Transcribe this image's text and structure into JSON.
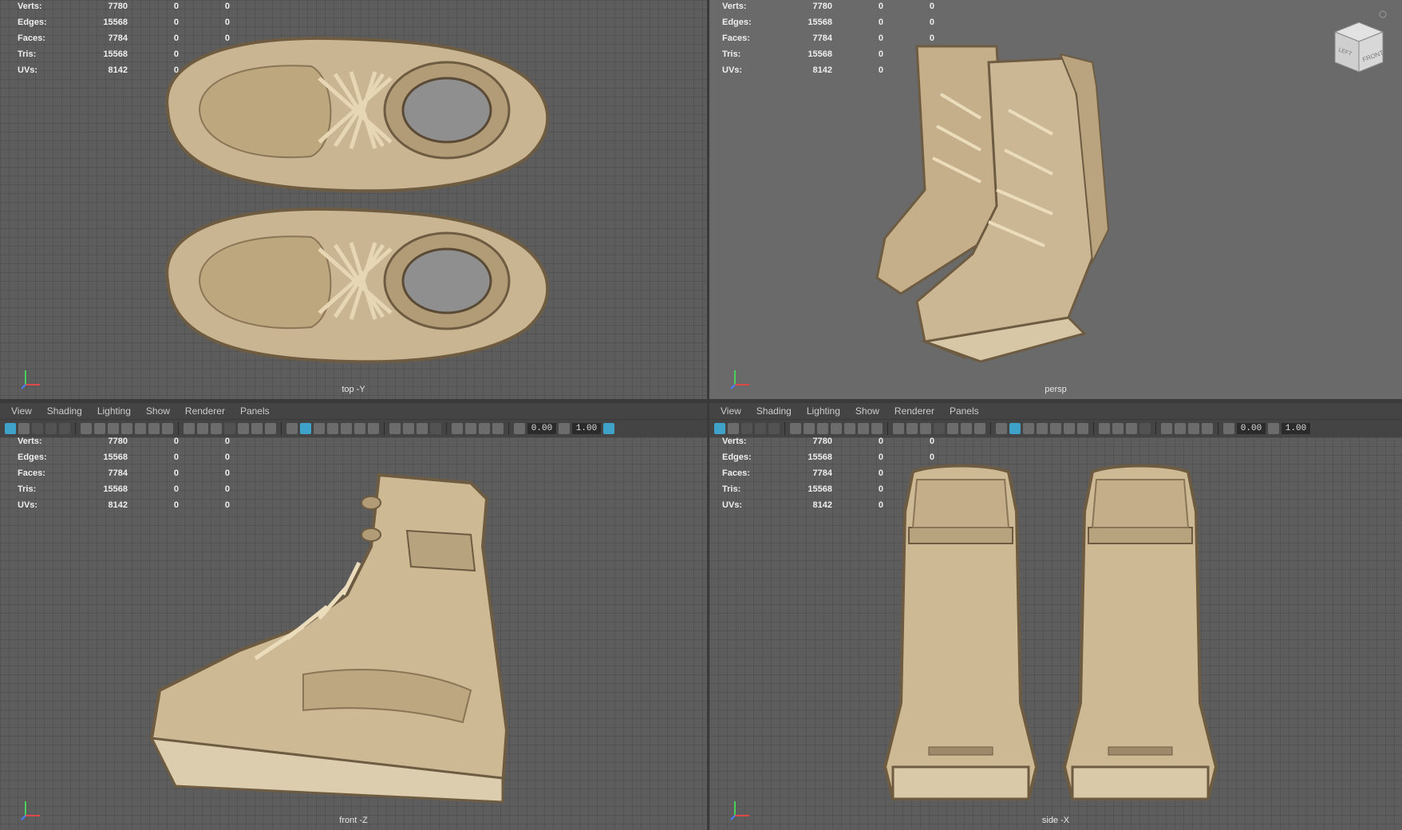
{
  "menu": [
    "View",
    "Shading",
    "Lighting",
    "Show",
    "Renderer",
    "Panels"
  ],
  "stats": [
    {
      "label": "Verts:",
      "value": "7780",
      "z1": "0",
      "z2": "0"
    },
    {
      "label": "Edges:",
      "value": "15568",
      "z1": "0",
      "z2": "0"
    },
    {
      "label": "Faces:",
      "value": "7784",
      "z1": "0",
      "z2": "0"
    },
    {
      "label": "Tris:",
      "value": "15568",
      "z1": "0",
      "z2": "0"
    },
    {
      "label": "UVs:",
      "value": "8142",
      "z1": "0",
      "z2": "0"
    }
  ],
  "toolbar": {
    "value_a": "0.00",
    "value_b": "1.00"
  },
  "viewports": {
    "top": {
      "camera": "top -Y"
    },
    "persp": {
      "camera": "persp"
    },
    "front": {
      "camera": "front -Z"
    },
    "side": {
      "camera": "side -X"
    }
  },
  "viewcube": {
    "face_front": "FRONT",
    "face_left": "LEFT"
  },
  "colors": {
    "accent": "#3fa3c9",
    "boot": "#c9b592",
    "boot_dark": "#8a7556",
    "background": "#5d5d5d"
  }
}
